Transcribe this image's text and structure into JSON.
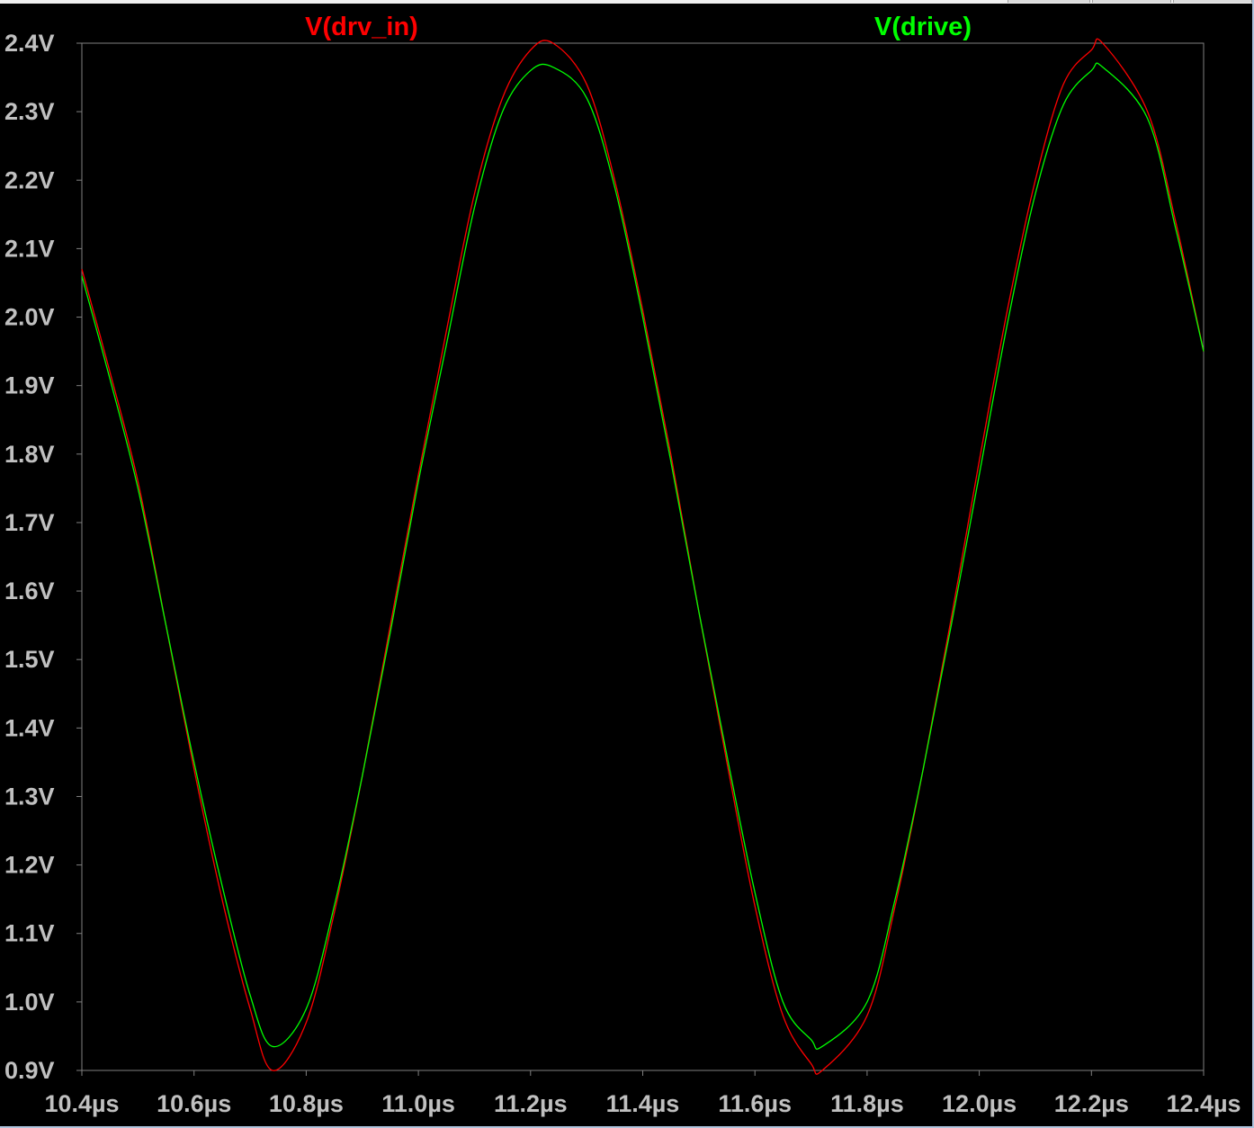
{
  "colors": {
    "background": "#000000",
    "frame": "#808080",
    "tick_label": "#c0c0c0",
    "series_drv_in": "#ff0000",
    "series_drive": "#00ff00"
  },
  "chart_data": {
    "type": "line",
    "title": "",
    "xlabel": "",
    "ylabel": "",
    "xlim": [
      10.4,
      12.4
    ],
    "ylim": [
      0.9,
      2.4
    ],
    "grid": false,
    "legend": "top",
    "x_tick_values": [
      10.4,
      10.6,
      10.8,
      11.0,
      11.2,
      11.4,
      11.6,
      11.8,
      12.0,
      12.2,
      12.4
    ],
    "x_tick_labels": [
      "10.4µs",
      "10.6µs",
      "10.8µs",
      "11.0µs",
      "11.2µs",
      "11.4µs",
      "11.6µs",
      "11.8µs",
      "12.0µs",
      "12.2µs",
      "12.4µs"
    ],
    "y_tick_values": [
      2.4,
      2.3,
      2.2,
      2.1,
      2.0,
      1.9,
      1.8,
      1.7,
      1.6,
      1.5,
      1.4,
      1.3,
      1.2,
      1.1,
      1.0,
      0.9
    ],
    "y_tick_labels": [
      "2.4V",
      "2.3V",
      "2.2V",
      "2.1V",
      "2.0V",
      "1.9V",
      "1.8V",
      "1.7V",
      "1.6V",
      "1.5V",
      "1.4V",
      "1.3V",
      "1.2V",
      "1.1V",
      "1.0V",
      "0.9V"
    ],
    "series": [
      {
        "name": "V(drv_in)",
        "color": "#ff0000",
        "x": [
          10.4,
          10.45,
          10.5,
          10.55,
          10.6,
          10.65,
          10.7,
          10.74,
          10.8,
          10.85,
          10.9,
          10.95,
          11.0,
          11.05,
          11.1,
          11.15,
          11.2,
          11.24,
          11.3,
          11.35,
          11.4,
          11.45,
          11.5,
          11.55,
          11.6,
          11.65,
          11.7,
          11.72,
          11.8,
          11.85,
          11.9,
          11.95,
          12.0,
          12.05,
          12.1,
          12.15,
          12.2,
          12.22,
          12.3,
          12.35,
          12.4
        ],
        "y": [
          2.07,
          1.92,
          1.76,
          1.55,
          1.34,
          1.15,
          0.99,
          0.9,
          0.97,
          1.13,
          1.33,
          1.55,
          1.77,
          1.98,
          2.18,
          2.32,
          2.39,
          2.4,
          2.34,
          2.2,
          2.01,
          1.8,
          1.57,
          1.35,
          1.14,
          0.98,
          0.91,
          0.9,
          0.98,
          1.14,
          1.34,
          1.56,
          1.79,
          2.01,
          2.2,
          2.34,
          2.39,
          2.4,
          2.3,
          2.14,
          1.95
        ]
      },
      {
        "name": "V(drive)",
        "color": "#00ff00",
        "x": [
          10.4,
          10.45,
          10.5,
          10.55,
          10.6,
          10.65,
          10.7,
          10.74,
          10.8,
          10.85,
          10.9,
          10.95,
          11.0,
          11.05,
          11.1,
          11.15,
          11.2,
          11.24,
          11.3,
          11.35,
          11.4,
          11.45,
          11.5,
          11.55,
          11.6,
          11.65,
          11.7,
          11.72,
          11.8,
          11.85,
          11.9,
          11.95,
          12.0,
          12.05,
          12.1,
          12.15,
          12.2,
          12.22,
          12.3,
          12.35,
          12.4
        ],
        "y": [
          2.06,
          1.91,
          1.75,
          1.55,
          1.35,
          1.17,
          1.01,
          0.935,
          0.99,
          1.14,
          1.33,
          1.54,
          1.76,
          1.96,
          2.16,
          2.3,
          2.36,
          2.365,
          2.32,
          2.19,
          2.0,
          1.79,
          1.57,
          1.36,
          1.16,
          1.0,
          0.945,
          0.935,
          1.0,
          1.15,
          1.34,
          1.55,
          1.77,
          1.99,
          2.18,
          2.31,
          2.36,
          2.365,
          2.29,
          2.13,
          1.95
        ]
      }
    ]
  }
}
